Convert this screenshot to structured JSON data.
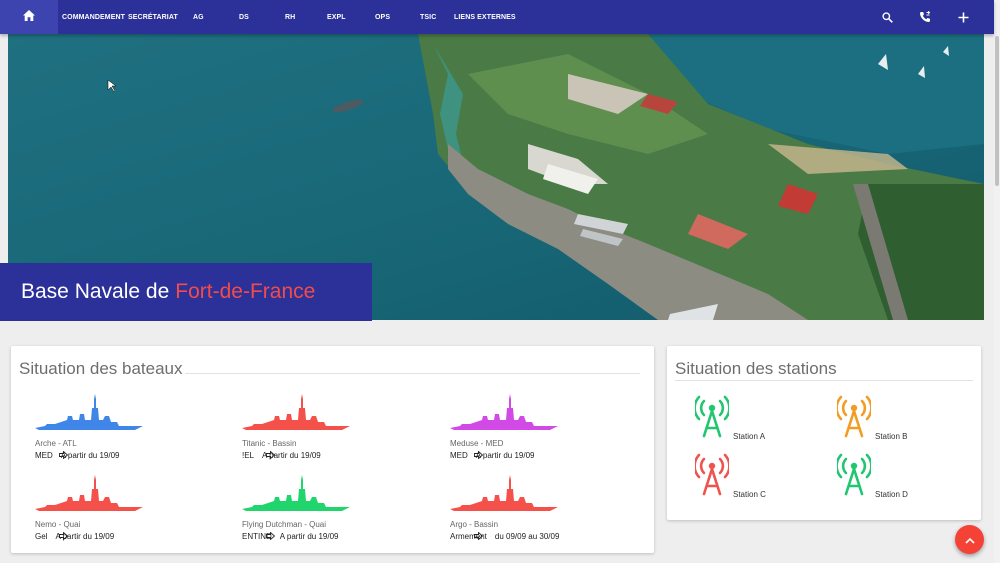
{
  "navbar": {
    "home_icon": "home-icon",
    "items": [
      {
        "label": "COMMANDEMENT"
      },
      {
        "label": "SECRÉTARIAT"
      },
      {
        "label": "AG"
      },
      {
        "label": "DS"
      },
      {
        "label": "RH"
      },
      {
        "label": "EXPL"
      },
      {
        "label": "OPS"
      },
      {
        "label": "TSIC"
      },
      {
        "label": "LIENS EXTERNES"
      }
    ],
    "right_icons": [
      "search-icon",
      "phone-forward-icon",
      "plus-icon"
    ],
    "color": "#2b3199"
  },
  "hero": {
    "title": "Base Navale de",
    "title_accent": "Fort-de-France",
    "accent_color": "#f24b4b"
  },
  "boats_card": {
    "title": "Situation des bateaux",
    "boats": [
      {
        "name": "Arche - ATL",
        "status": "MED",
        "date": "A partir du 19/09",
        "color": "#3f86e8"
      },
      {
        "name": "Titanic - Bassin",
        "status": "!EL",
        "date": "A partir du 19/09",
        "color": "#f4514b"
      },
      {
        "name": "Meduse - MED",
        "status": "MED",
        "date": "A partir du 19/09",
        "color": "#d24ae6"
      },
      {
        "name": "Nemo - Quai",
        "status": "Gel",
        "date": "A partir du 19/09",
        "color": "#f4514b"
      },
      {
        "name": "Flying Dutchman - Quai",
        "status": "ENTIND",
        "date": "A partir du 19/09",
        "color": "#20d56b"
      },
      {
        "name": "Argo - Bassin",
        "status": "Armement",
        "date": "du 09/09 au 30/09",
        "color": "#f4514b"
      }
    ]
  },
  "stations_card": {
    "title": "Situation des stations",
    "stations": [
      {
        "name": "Station A",
        "color": "#20c670"
      },
      {
        "name": "Station B",
        "color": "#f39c23"
      },
      {
        "name": "Station C",
        "color": "#ef5350"
      },
      {
        "name": "Station D",
        "color": "#20c670"
      }
    ]
  },
  "fab": {
    "icon": "chevron-up-icon",
    "color": "#f44336"
  }
}
